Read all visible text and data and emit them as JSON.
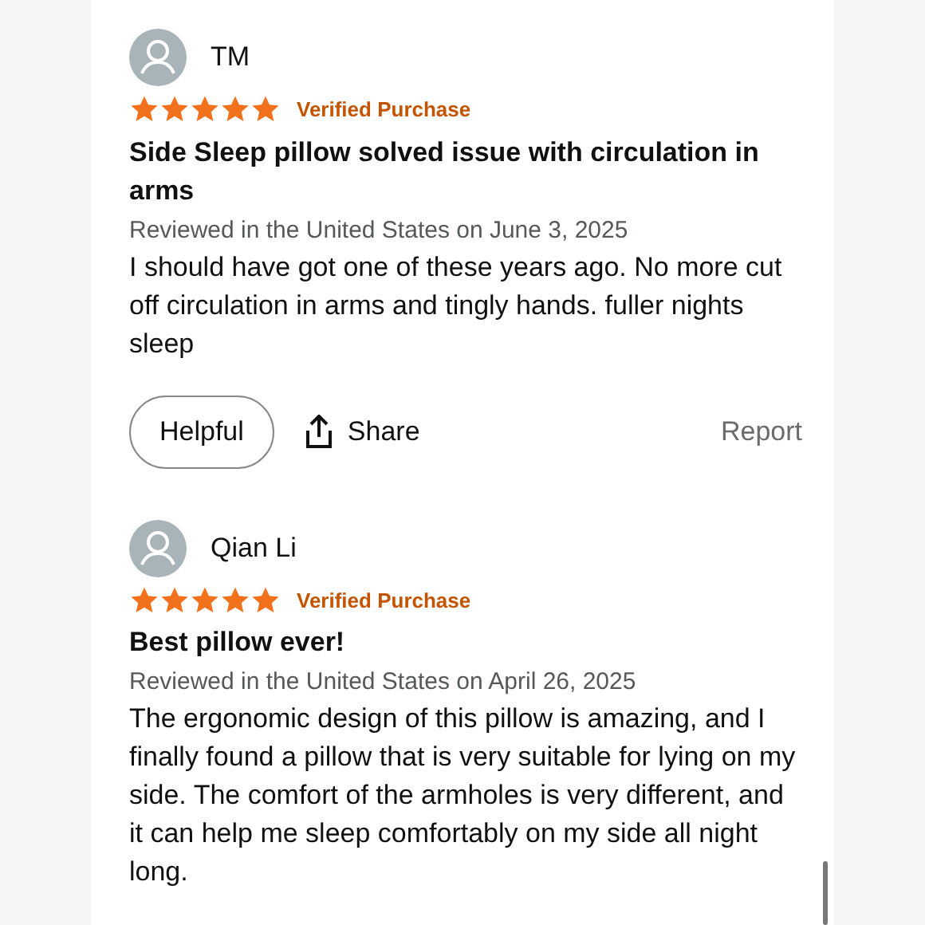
{
  "reviews": [
    {
      "author": "TM",
      "stars": 5,
      "badge": "Verified Purchase",
      "title": "Side Sleep pillow solved issue with circulation in arms",
      "meta": "Reviewed in the United States on June 3, 2025",
      "body": "I should have got one of these years ago. No more cut off circulation in arms and tingly hands. fuller nights sleep",
      "actions": {
        "helpful": "Helpful",
        "share": "Share",
        "report": "Report"
      }
    },
    {
      "author": "Qian Li",
      "stars": 5,
      "badge": "Verified Purchase",
      "title": "Best pillow ever!",
      "meta": "Reviewed in the United States on April 26, 2025",
      "body": "The ergonomic design of this pillow is amazing, and I finally found a pillow that is very suitable for lying on my side. The comfort of the armholes is very different, and it can help me sleep comfortably on my side all night long."
    }
  ]
}
